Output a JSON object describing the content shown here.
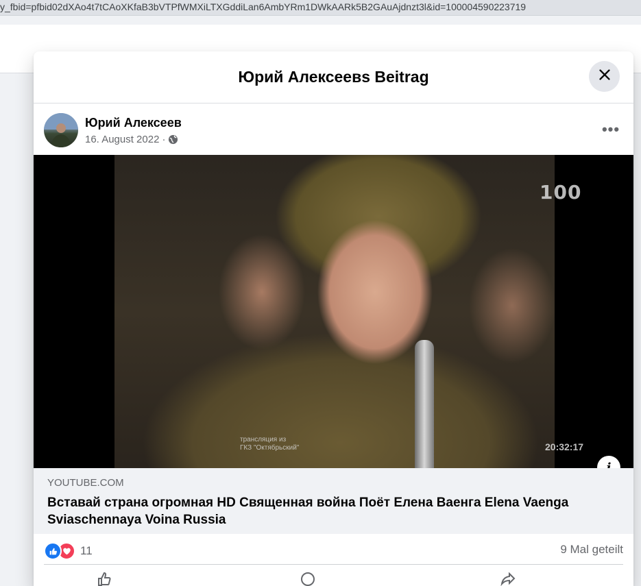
{
  "browser": {
    "url": "y_fbid=pfbid02dXAo4t7tCAoXKfaB3bVTPfWMXiLTXGddiLan6AmbYRm1DWkAARk5B2GAuAjdnzt3l&id=100004590223719"
  },
  "modal": {
    "title": "Юрий Алексеевs Beitrag",
    "close_icon": "close-icon"
  },
  "post": {
    "author": "Юрий Алексеев",
    "date": "16. August 2022",
    "separator": "·",
    "privacy_icon": "globe-icon",
    "more_label": "•••"
  },
  "video": {
    "overlay_logo": "100",
    "overlay_time": "20:32:17",
    "overlay_caption_line1": "трансляция из",
    "overlay_caption_line2": "ГКЗ \"Октябрьский\"",
    "info_label": "i"
  },
  "link": {
    "domain": "YOUTUBE.COM",
    "title": "Вставай страна огромная HD Священная война Поёт Елена Ваенга Elena Vaenga Sviaschennaya Voina Russia"
  },
  "reactions": {
    "count": "11",
    "shares": "9 Mal geteilt",
    "like_color": "#1877f2",
    "love_color": "#f33e58"
  }
}
